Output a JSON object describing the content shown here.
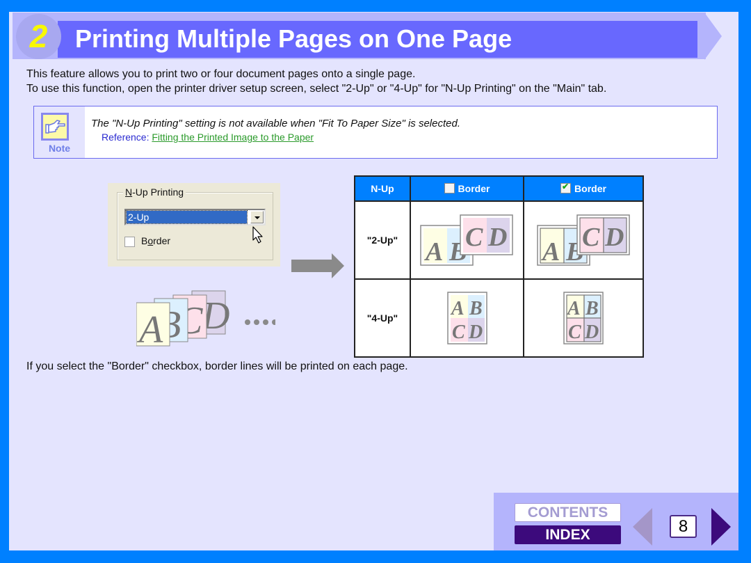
{
  "header": {
    "step_number": "2",
    "title": "Printing Multiple Pages on One Page"
  },
  "intro": {
    "line1": "This feature allows you to print two or four document pages onto a single page.",
    "line2": "To use this function, open the printer driver setup screen, select \"2-Up\" or \"4-Up\" for \"N-Up Printing\" on the \"Main\" tab."
  },
  "note": {
    "icon": "pointing-hand-icon",
    "label": "Note",
    "text": "The \"N-Up Printing\" setting is not available when \"Fit To Paper Size\" is selected.",
    "reference_prefix": "Reference: ",
    "reference_link": "Fitting the Printed Image to the Paper"
  },
  "dialog": {
    "group_label_hotkey": "N",
    "group_label_rest": "-Up Printing",
    "select_value": "2-Up",
    "border_label_pre": "B",
    "border_label_hotkey": "o",
    "border_label_post": "rder",
    "border_checked": false
  },
  "illustration": {
    "pages": [
      "A",
      "B",
      "C",
      "D"
    ],
    "ellipsis": "••••"
  },
  "table": {
    "headers": [
      "N-Up",
      "Border",
      "Border"
    ],
    "header_checkbox_states": [
      false,
      true
    ],
    "rows": [
      {
        "label": "\"2-Up\"",
        "mode": "2-Up"
      },
      {
        "label": "\"4-Up\"",
        "mode": "4-Up"
      }
    ]
  },
  "bottom_note": "If you select the \"Border\" checkbox, border lines will be printed on each page.",
  "footer": {
    "contents_label": "CONTENTS",
    "index_label": "INDEX",
    "page_number": "8",
    "colors": {
      "index_bg": "#3c0a7c",
      "prev_arrow": "#a496c8",
      "next_arrow": "#3c0a7c"
    }
  },
  "colors": {
    "frame": "#0080ff",
    "page_bg": "#e4e4fe",
    "title_bar": "#6868fe",
    "title_band": "#b4b4fc",
    "step_number": "#f8f800",
    "link": "#2a9a2a",
    "reference": "#2a2ad0"
  }
}
